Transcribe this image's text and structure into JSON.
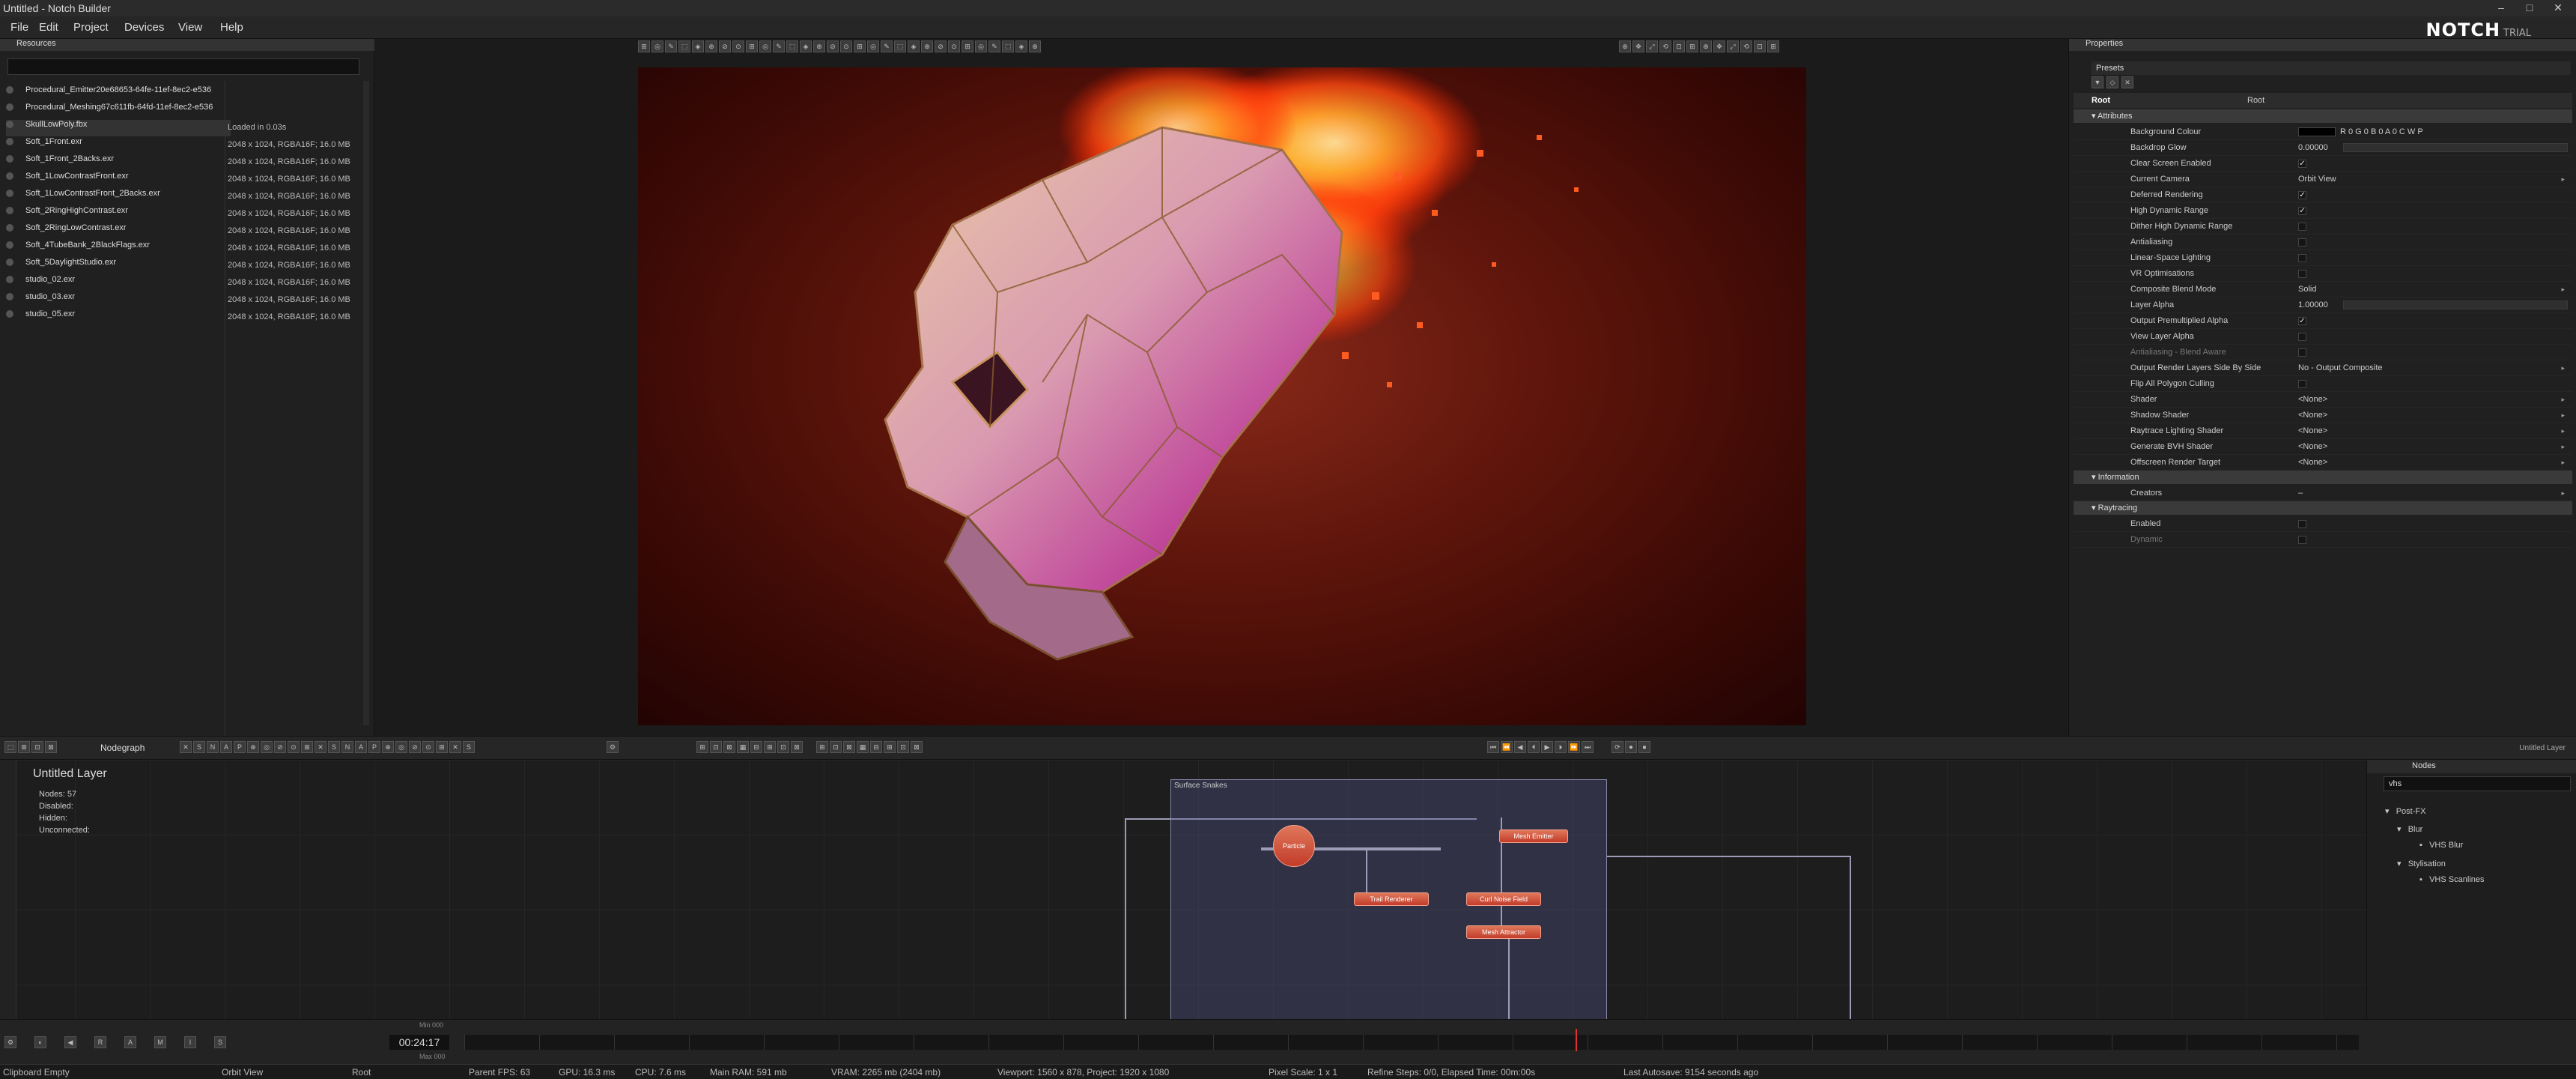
{
  "window": {
    "title": "Untitled - Notch Builder",
    "min": "–",
    "max": "□",
    "close": "✕"
  },
  "menu": [
    "File",
    "Edit",
    "Project",
    "Devices",
    "View",
    "Help"
  ],
  "logo": {
    "main": "NOTCH",
    "sub": "TRIAL"
  },
  "resources": {
    "header": "Resources",
    "items": [
      {
        "name": "Procedural_Emitter20e68653-64fe-11ef-8ec2-e536",
        "info": ""
      },
      {
        "name": "Procedural_Meshing67c611fb-64fd-11ef-8ec2-e536",
        "info": ""
      },
      {
        "name": "SkullLowPoly.fbx",
        "info": "Loaded in 0.03s"
      },
      {
        "name": "Soft_1Front.exr",
        "info": "2048 x 1024, RGBA16F; 16.0 MB"
      },
      {
        "name": "Soft_1Front_2Backs.exr",
        "info": "2048 x 1024, RGBA16F; 16.0 MB"
      },
      {
        "name": "Soft_1LowContrastFront.exr",
        "info": "2048 x 1024, RGBA16F; 16.0 MB"
      },
      {
        "name": "Soft_1LowContrastFront_2Backs.exr",
        "info": "2048 x 1024, RGBA16F; 16.0 MB"
      },
      {
        "name": "Soft_2RingHighContrast.exr",
        "info": "2048 x 1024, RGBA16F; 16.0 MB"
      },
      {
        "name": "Soft_2RingLowContrast.exr",
        "info": "2048 x 1024, RGBA16F; 16.0 MB"
      },
      {
        "name": "Soft_4TubeBank_2BlackFlags.exr",
        "info": "2048 x 1024, RGBA16F; 16.0 MB"
      },
      {
        "name": "Soft_5DaylightStudio.exr",
        "info": "2048 x 1024, RGBA16F; 16.0 MB"
      },
      {
        "name": "studio_02.exr",
        "info": "2048 x 1024, RGBA16F; 16.0 MB"
      },
      {
        "name": "studio_03.exr",
        "info": "2048 x 1024, RGBA16F; 16.0 MB"
      },
      {
        "name": "studio_05.exr",
        "info": "2048 x 1024, RGBA16F; 16.0 MB"
      }
    ]
  },
  "properties": {
    "header": "Properties",
    "presets": "Presets",
    "root_label": "Root",
    "root_value": "Root",
    "sections": {
      "attributes": "Attributes",
      "information": "Information",
      "raytracing": "Raytracing"
    },
    "attributes": [
      {
        "label": "Background Colour",
        "value": "R 0 G 0 B 0 A 0     C  W  P",
        "type": "color"
      },
      {
        "label": "Backdrop Glow",
        "value": "0.00000",
        "type": "bar"
      },
      {
        "label": "Clear Screen Enabled",
        "value": "✓",
        "type": "check"
      },
      {
        "label": "Current Camera",
        "value": "Orbit View",
        "type": "text"
      },
      {
        "label": "Deferred Rendering",
        "value": "✓",
        "type": "check"
      },
      {
        "label": "High Dynamic Range",
        "value": "✓",
        "type": "check"
      },
      {
        "label": "Dither High Dynamic Range",
        "value": "",
        "type": "check"
      },
      {
        "label": "Antialiasing",
        "value": "",
        "type": "check"
      },
      {
        "label": "Linear-Space Lighting",
        "value": "",
        "type": "check"
      },
      {
        "label": "VR Optimisations",
        "value": "",
        "type": "check"
      },
      {
        "label": "Composite Blend Mode",
        "value": "Solid",
        "type": "text"
      },
      {
        "label": "Layer Alpha",
        "value": "1.00000",
        "type": "bar"
      },
      {
        "label": "Output Premultiplied Alpha",
        "value": "✓",
        "type": "check"
      },
      {
        "label": "View Layer Alpha",
        "value": "",
        "type": "check"
      },
      {
        "label": "Antialiasing - Blend Aware",
        "value": "",
        "type": "check"
      },
      {
        "label": "Output Render Layers Side By Side",
        "value": "No - Output Composite",
        "type": "text"
      },
      {
        "label": "Flip All Polygon Culling",
        "value": "",
        "type": "check"
      },
      {
        "label": "Shader",
        "value": "<None>",
        "type": "text"
      },
      {
        "label": "Shadow Shader",
        "value": "<None>",
        "type": "text"
      },
      {
        "label": "Raytrace Lighting Shader",
        "value": "<None>",
        "type": "text"
      },
      {
        "label": "Generate BVH Shader",
        "value": "<None>",
        "type": "text"
      },
      {
        "label": "Offscreen Render Target",
        "value": "<None>",
        "type": "text"
      }
    ],
    "information": [
      {
        "label": "Creators",
        "value": "–"
      }
    ],
    "raytracing": [
      {
        "label": "Enabled",
        "value": ""
      },
      {
        "label": "Dynamic",
        "value": ""
      }
    ]
  },
  "nodegraph": {
    "tab": "Nodegraph",
    "layer_title": "Untitled  Layer",
    "stats": [
      "Nodes:  57",
      "Disabled:",
      "Hidden:",
      "Unconnected:"
    ],
    "group_title": "Surface Snakes",
    "nodes": {
      "particle": "Particle",
      "mesh_emitter": "Mesh Emitter",
      "trail_renderer": "Trail Renderer",
      "curl_noise": "Curl Noise Field",
      "mesh_attractor": "Mesh Attractor"
    }
  },
  "nodes_panel": {
    "tabs": [
      "Nodes"
    ],
    "corner_label": "Untitled Layer",
    "search": "vhs",
    "tree": [
      "Post-FX",
      "Blur",
      "VHS Blur",
      "Stylisation",
      "VHS Scanlines"
    ]
  },
  "timeline": {
    "time": "00:24:17",
    "min_label": "Min 000",
    "max_label": "Max 000"
  },
  "status": {
    "clipboard": "Clipboard Empty",
    "camera": "Orbit View",
    "root": "Root",
    "fps": "Parent  FPS: 63",
    "gpu": "GPU: 16.3 ms",
    "cpu": "CPU: 7.6 ms",
    "ram": "Main RAM: 591 mb",
    "vram": "VRAM: 2265 mb (2404 mb)",
    "viewport": "Viewport: 1560 x 878, Project: 1920 x 1080",
    "pixel": "Pixel Scale: 1 x 1",
    "refine": "Refine Steps: 0/0, Elapsed Time: 00m:00s",
    "autosave": "Last Autosave: 9154 seconds ago"
  }
}
